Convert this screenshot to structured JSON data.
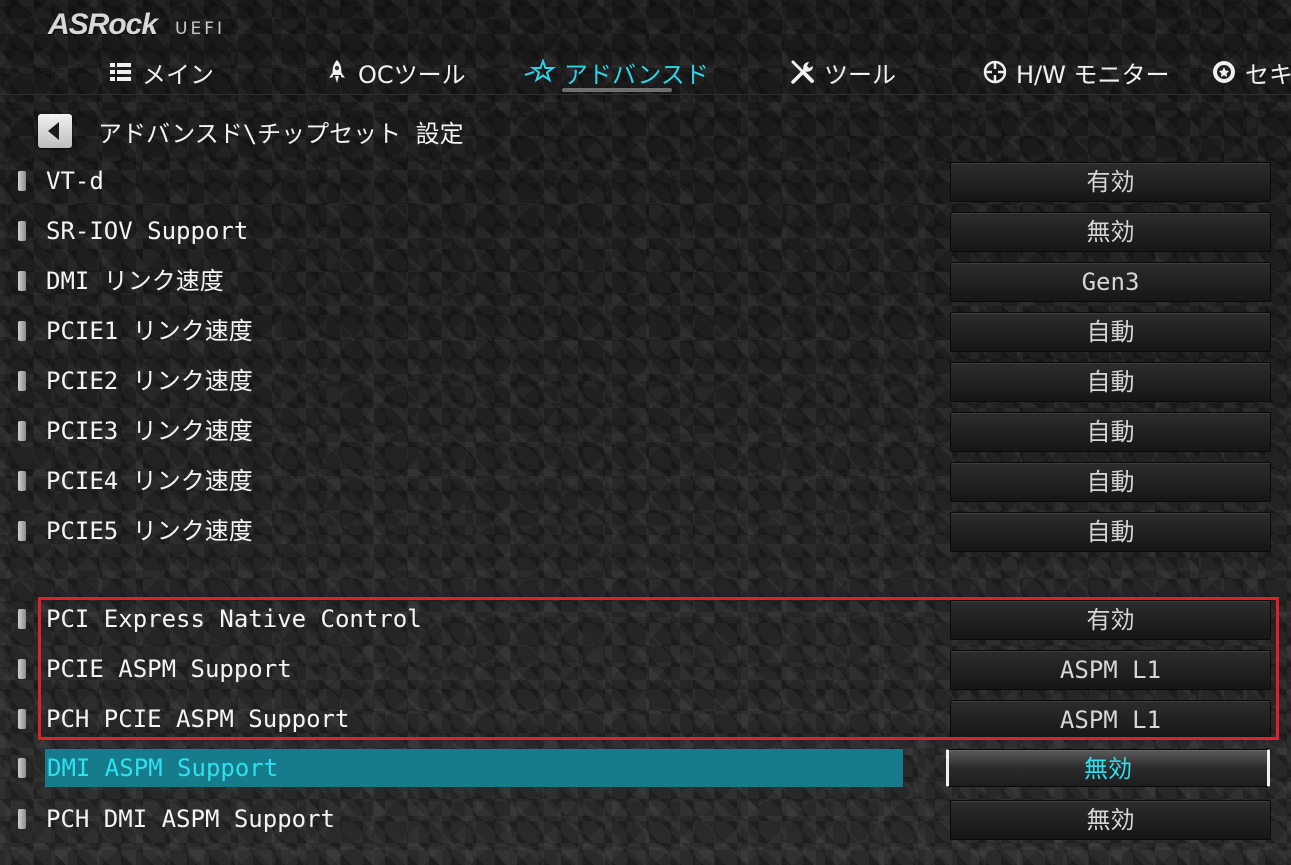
{
  "header": {
    "brand": "ASRock",
    "subtitle": "UEFI"
  },
  "nav": {
    "items": [
      {
        "label": "メイン",
        "icon": "list-icon"
      },
      {
        "label": "OCツール",
        "icon": "rocket-icon"
      },
      {
        "label": "アドバンスド",
        "icon": "star-icon",
        "active": true
      },
      {
        "label": "ツール",
        "icon": "tools-icon"
      },
      {
        "label": "H/W モニター",
        "icon": "crosshair-icon"
      },
      {
        "label": "セキ",
        "icon": "shield-badge-icon"
      }
    ]
  },
  "breadcrumb": {
    "path": "アドバンスド\\チップセット 設定"
  },
  "settings": {
    "rows": [
      {
        "label": "VT-d",
        "value": "有効"
      },
      {
        "label": "SR-IOV Support",
        "value": "無効"
      },
      {
        "label": "DMI リンク速度",
        "value": "Gen3"
      },
      {
        "label": "PCIE1 リンク速度",
        "value": "自動"
      },
      {
        "label": "PCIE2 リンク速度",
        "value": "自動"
      },
      {
        "label": "PCIE3 リンク速度",
        "value": "自動"
      },
      {
        "label": "PCIE4 リンク速度",
        "value": "自動"
      },
      {
        "label": "PCIE5 リンク速度",
        "value": "自動"
      },
      {
        "label": "PCI Express Native Control",
        "value": "有効"
      },
      {
        "label": "PCIE ASPM Support",
        "value": "ASPM L1"
      },
      {
        "label": "PCH PCIE ASPM Support",
        "value": "ASPM L1"
      },
      {
        "label": "DMI ASPM Support",
        "value": "無効",
        "selected": true
      },
      {
        "label": "PCH DMI ASPM Support",
        "value": "無効"
      }
    ]
  },
  "colors": {
    "accent": "#2ed3e6",
    "selection_bg": "#167b8a",
    "highlight_border": "#e0202c"
  }
}
